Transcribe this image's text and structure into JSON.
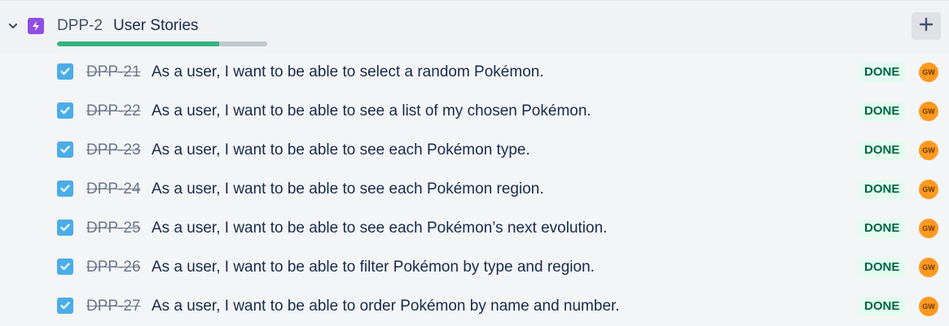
{
  "epic": {
    "key": "DPP-2",
    "title": "User Stories",
    "progress_fraction": 0.77
  },
  "colors": {
    "epic_icon": "#904ee2",
    "checkbox": "#4bade8",
    "progress_done": "#36b37e",
    "done_lozenge_bg": "#e3fcef",
    "done_lozenge_text": "#006644",
    "avatar": "#ff991f"
  },
  "icons": {
    "collapse": "chevron-down-icon",
    "epic": "lightning-bolt-icon",
    "add": "plus-icon",
    "checkbox": "checkmark-icon"
  },
  "stories": [
    {
      "key": "DPP-21",
      "summary": "As a user, I want to be able to select a random Pokémon.",
      "status": "DONE",
      "assignee": "GW"
    },
    {
      "key": "DPP-22",
      "summary": "As a user, I want to be able to see a list of my chosen Pokémon.",
      "status": "DONE",
      "assignee": "GW"
    },
    {
      "key": "DPP-23",
      "summary": "As a user, I want to be able to see each Pokémon type.",
      "status": "DONE",
      "assignee": "GW"
    },
    {
      "key": "DPP-24",
      "summary": "As a user, I want to be able to see each Pokémon region.",
      "status": "DONE",
      "assignee": "GW"
    },
    {
      "key": "DPP-25",
      "summary": "As a user, I want to be able to see each Pokémon’s next evolution.",
      "status": "DONE",
      "assignee": "GW"
    },
    {
      "key": "DPP-26",
      "summary": "As a user, I want to be able to filter Pokémon by type and region.",
      "status": "DONE",
      "assignee": "GW"
    },
    {
      "key": "DPP-27",
      "summary": "As a user, I want to be able to order Pokémon by name and number.",
      "status": "DONE",
      "assignee": "GW"
    }
  ]
}
